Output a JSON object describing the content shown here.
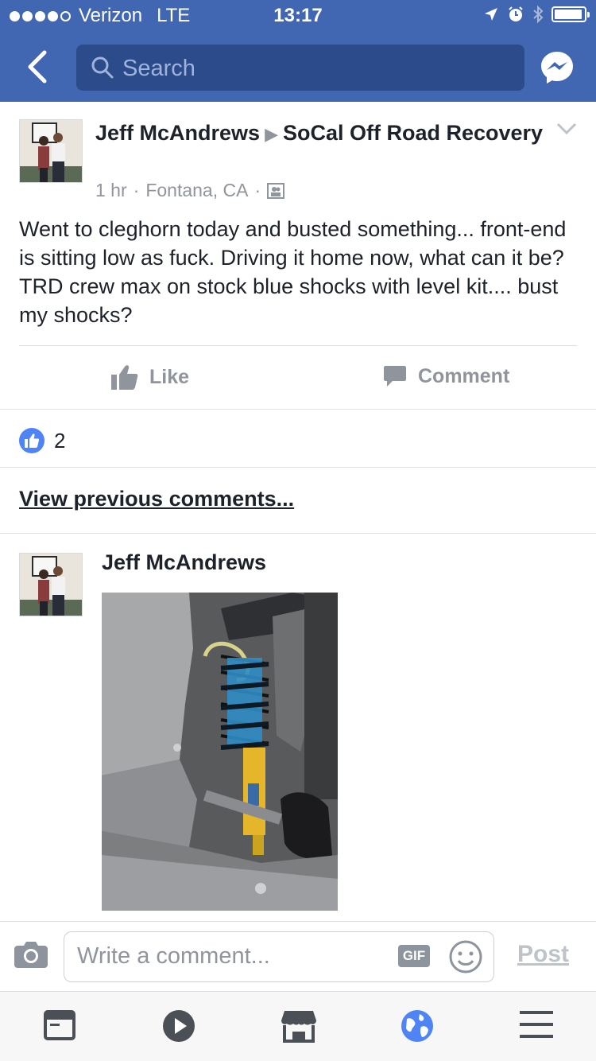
{
  "status_bar": {
    "carrier": "Verizon",
    "network": "LTE",
    "time": "13:17",
    "signal_bars": 4,
    "signal_max": 5,
    "battery_level": 0.85
  },
  "nav": {
    "search_placeholder": "Search",
    "accent_color": "#4267b2"
  },
  "post": {
    "author": "Jeff McAndrews",
    "group": "SoCal Off Road Recovery",
    "time": "1 hr",
    "location": "Fontana, CA",
    "separator": "·",
    "text": "Went to cleghorn today and busted something... front-end is sitting low as fuck.  Driving it home now, what can it be?  TRD  crew max on stock blue shocks with level kit.... bust my shocks?"
  },
  "actions": {
    "like_label": "Like",
    "comment_label": "Comment"
  },
  "reactions": {
    "count": "2"
  },
  "comments": {
    "view_previous_label": "View previous comments...",
    "items": [
      {
        "author": "Jeff McAndrews",
        "has_photo": true
      }
    ]
  },
  "composer": {
    "placeholder": "Write a comment...",
    "gif_label": "GIF",
    "post_label": "Post"
  },
  "tabbar": {
    "items": [
      "news-feed-icon",
      "video-icon",
      "marketplace-icon",
      "globe-notifications-icon",
      "menu-icon"
    ],
    "active_index": 3
  }
}
